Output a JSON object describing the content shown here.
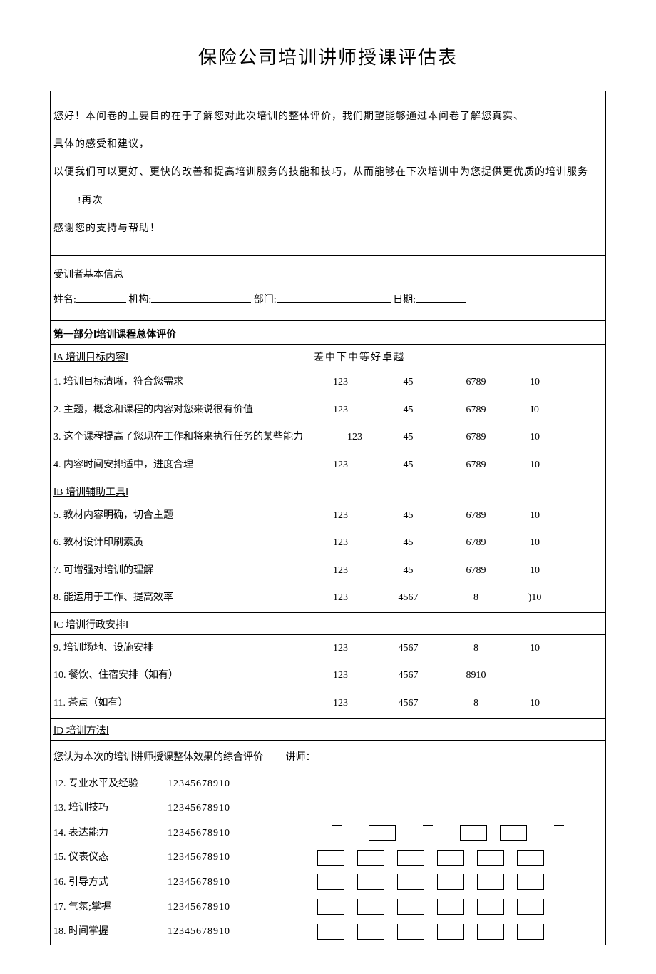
{
  "title": "保险公司培训讲师授课评估表",
  "intro": {
    "p1a": "您好！本问卷的主要目的在于了解您对此次培训的整体评价，我们期望能够通过本问卷了解您真实、",
    "p1b": "具体的感受和建议，",
    "p2a": "以便我们可以更好、更快的改善和提高培训服务的技能和技巧，从而能够在下次培训中为您提供更优质的培训服务",
    "p2b": "!再次",
    "p3": "感谢您的支持与帮助！"
  },
  "trainee_header": "受训者基本信息",
  "labels": {
    "name": "姓名:",
    "org": "机构:",
    "dept": "部门:",
    "date": "日期:"
  },
  "part1_header": "第一部分Ⅰ培训课程总体评价",
  "secA": "ⅠA 培训目标内容Ⅰ",
  "scale_header": "差中下中等好卓越",
  "rowsA": [
    {
      "label": "1. 培训目标清晰，符合您需求",
      "c1": "123",
      "c2": "45",
      "c3": "6789",
      "c4": "10"
    },
    {
      "label": "2. 主题，概念和课程的内容对您来说很有价值",
      "c1": "123",
      "c2": "45",
      "c3": "6789",
      "c4": "I0"
    },
    {
      "label": "3. 这个课程提高了您现在工作和将来执行任务的某些能力",
      "c1": "123",
      "c2": "45",
      "c3": "6789",
      "c4": "10",
      "tight": true
    },
    {
      "label": "4. 内容时间安排适中，进度合理",
      "c1": "123",
      "c2": "45",
      "c3": "6789",
      "c4": "10"
    }
  ],
  "secB": "ⅠB 培训辅助工具Ⅰ",
  "rowsB": [
    {
      "label": "5. 教材内容明确，切合主题",
      "c1": "123",
      "c2": "45",
      "c3": "6789",
      "c4": "10"
    },
    {
      "label": "6. 教材设计印刷素质",
      "c1": "123",
      "c2": "45",
      "c3": "6789",
      "c4": "10"
    },
    {
      "label": "7. 可增强对培训的理解",
      "c1": "123",
      "c2": "45",
      "c3": "6789",
      "c4": "10"
    },
    {
      "label": "8. 能运用于工作、提高效率",
      "c1": "123",
      "c2": "4567",
      "c3": "8",
      "c4": ")10"
    }
  ],
  "secC": "ⅠC 培训行政安排Ⅰ",
  "rowsC": [
    {
      "label": "9. 培训场地、设施安排",
      "c1": "123",
      "c2": "4567",
      "c3": "8",
      "c4": "10"
    },
    {
      "label": "10. 餐饮、住宿安排（如有）",
      "c1": "123",
      "c2": "4567",
      "c3": "8910",
      "c4": ""
    },
    {
      "label": "11. 茶点（如有）",
      "c1": "123",
      "c2": "4567",
      "c3": "8",
      "c4": "10"
    }
  ],
  "secD": "ⅠD 培训方法Ⅰ",
  "d_intro": "您认为本次的培训讲师授课整体效果的综合评价",
  "d_lecturer": "讲师：",
  "rowsD": [
    {
      "label": "12. 专业水平及经验",
      "scale": "12345678910"
    },
    {
      "label": "13. 培训技巧",
      "scale": "12345678910"
    },
    {
      "label": "14. 表达能力",
      "scale": "12345678910"
    },
    {
      "label": "15. 仪表仪态",
      "scale": "12345678910"
    },
    {
      "label": "16. 引导方式",
      "scale": "12345678910"
    },
    {
      "label": "17. 气氛;掌握",
      "scale": "12345678910"
    },
    {
      "label": "18. 时间掌握",
      "scale": "12345678910"
    }
  ]
}
